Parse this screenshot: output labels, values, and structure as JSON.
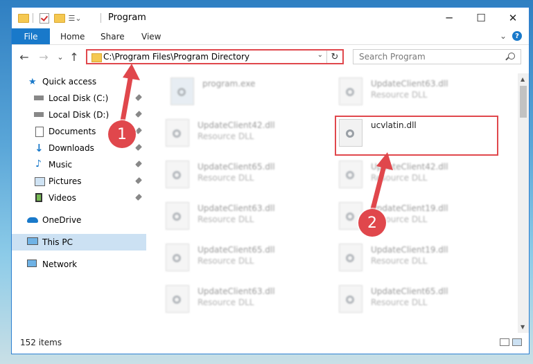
{
  "window": {
    "title": "Program",
    "controls": {
      "minimize": "─",
      "maximize": "☐",
      "close": "✕"
    }
  },
  "ribbon": {
    "tabs": [
      "File",
      "Home",
      "Share",
      "View"
    ],
    "chevron": "⌄",
    "help": "?"
  },
  "nav": {
    "back": "←",
    "forward": "→",
    "recent": "⌄",
    "up": "↑",
    "address": "C:\\Program Files\\Program Directory",
    "address_dropdown": "⌄",
    "refresh": "↻",
    "search_placeholder": "Search Program"
  },
  "sidebar": {
    "items": [
      {
        "label": "Quick access",
        "icon": "star-icon",
        "pinned": false,
        "level": 0
      },
      {
        "label": "Local Disk (C:)",
        "icon": "drive-icon",
        "pinned": true,
        "level": 1
      },
      {
        "label": "Local Disk (D:)",
        "icon": "drive-icon",
        "pinned": true,
        "level": 1
      },
      {
        "label": "Documents",
        "icon": "documents-icon",
        "pinned": true,
        "level": 1
      },
      {
        "label": "Downloads",
        "icon": "download-arrow-icon",
        "pinned": true,
        "level": 1
      },
      {
        "label": "Music",
        "icon": "music-note-icon",
        "pinned": true,
        "level": 1
      },
      {
        "label": "Pictures",
        "icon": "pictures-icon",
        "pinned": true,
        "level": 1
      },
      {
        "label": "Videos",
        "icon": "video-film-icon",
        "pinned": true,
        "level": 1
      },
      {
        "label": "OneDrive",
        "icon": "cloud-icon",
        "pinned": false,
        "level": 0
      },
      {
        "label": "This PC",
        "icon": "monitor-icon",
        "pinned": false,
        "level": 0,
        "selected": true
      },
      {
        "label": "Network",
        "icon": "network-icon",
        "pinned": false,
        "level": 0
      }
    ]
  },
  "files": [
    {
      "name": "program.exe",
      "type": ""
    },
    {
      "name": "UpdateClient63.dll",
      "type": "Resource DLL"
    },
    {
      "name": "UpdateClient42.dll",
      "type": "Resource DLL"
    },
    {
      "name": "ucvlatin.dll",
      "type": ""
    },
    {
      "name": "UpdateClient65.dll",
      "type": "Resource DLL"
    },
    {
      "name": "UpdateClient42.dll",
      "type": "Resource DLL"
    },
    {
      "name": "UpdateClient63.dll",
      "type": "Resource DLL"
    },
    {
      "name": "UpdateClient19.dll",
      "type": "Resource DLL"
    },
    {
      "name": "UpdateClient65.dll",
      "type": "Resource DLL"
    },
    {
      "name": "UpdateClient19.dll",
      "type": "Resource DLL"
    },
    {
      "name": "UpdateClient63.dll",
      "type": "Resource DLL"
    },
    {
      "name": "UpdateClient65.dll",
      "type": "Resource DLL"
    }
  ],
  "status": {
    "item_count": "152 items"
  },
  "markers": [
    "1",
    "2"
  ],
  "colors": {
    "accent": "#1979ca",
    "highlight": "#e0474c",
    "selected": "#cce1f3"
  }
}
